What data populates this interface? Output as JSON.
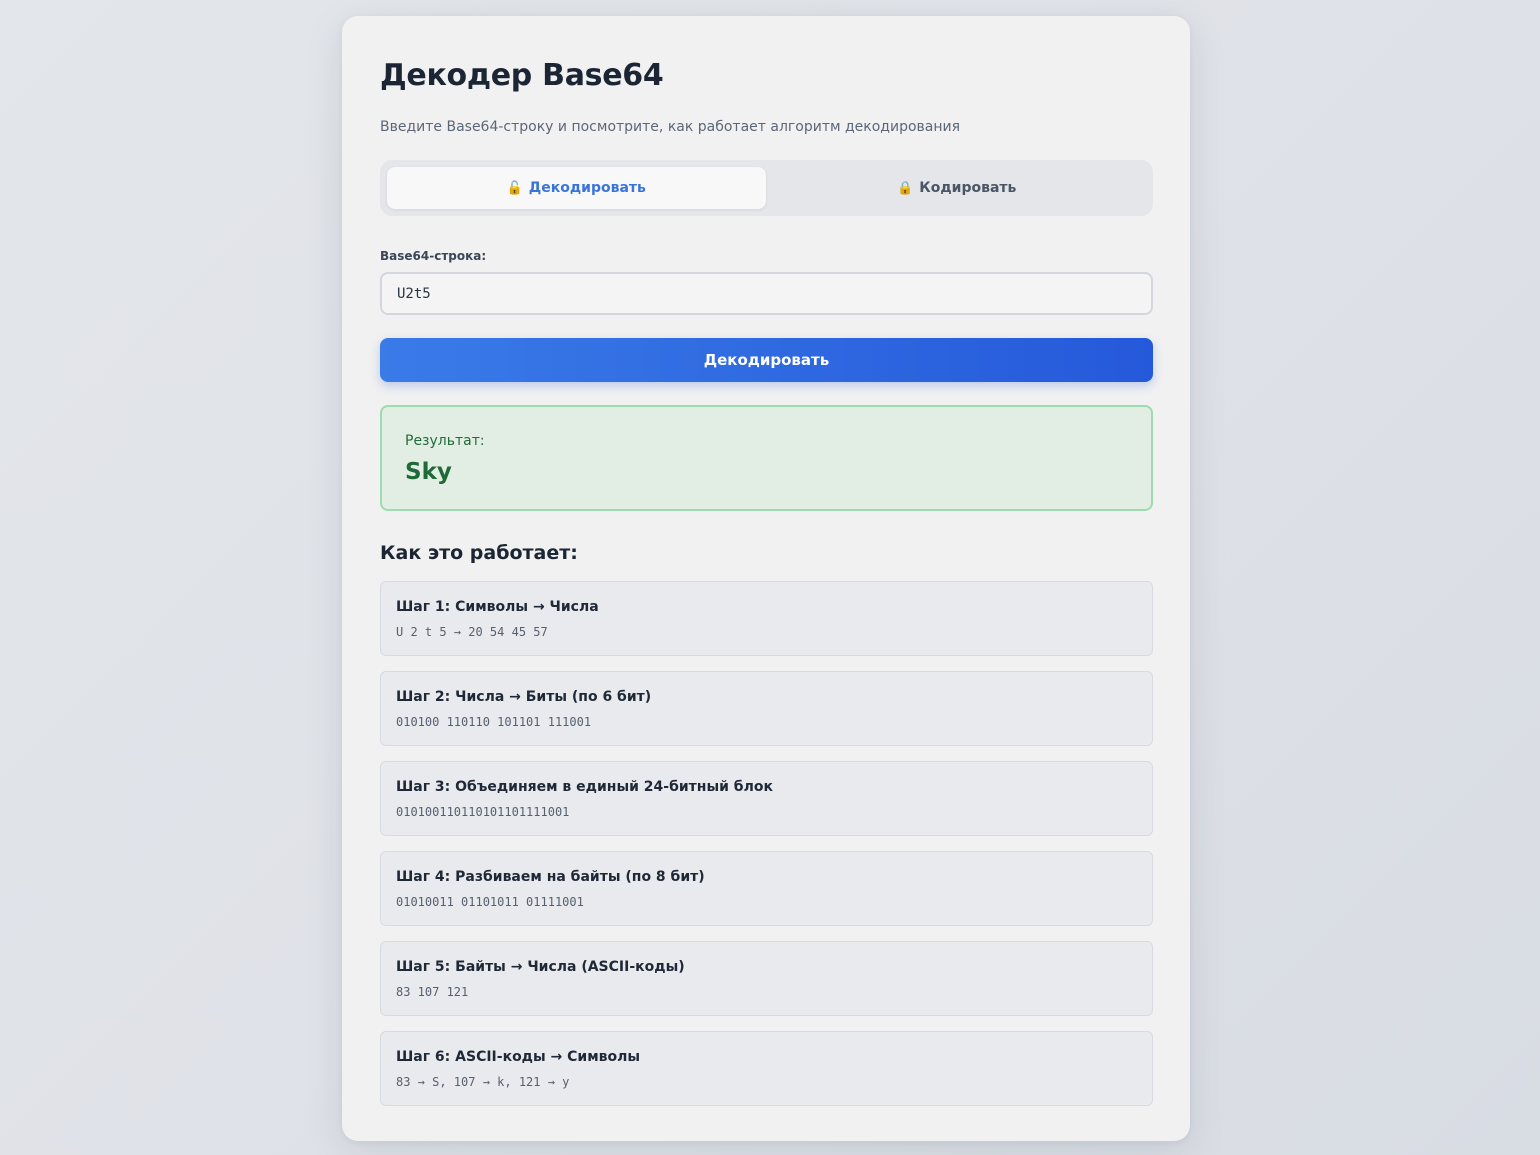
{
  "header": {
    "title": "Декодер Base64",
    "subtitle": "Введите Base64-строку и посмотрите, как работает алгоритм декодирования"
  },
  "tabs": [
    {
      "label": "Декодировать",
      "icon": "unlocked-icon",
      "glyph": "🔓",
      "active": true
    },
    {
      "label": "Кодировать",
      "icon": "locked-icon",
      "glyph": "🔒",
      "active": false
    }
  ],
  "input": {
    "label": "Base64-строка:",
    "value": "U2t5"
  },
  "decode_button": {
    "label": "Декодировать"
  },
  "result": {
    "label": "Результат:",
    "value": "Sky"
  },
  "how_it_works": {
    "title": "Как это работает:",
    "steps": [
      {
        "title": "Шаг 1: Символы → Числа",
        "detail": "U 2 t 5 → 20 54 45 57"
      },
      {
        "title": "Шаг 2: Числа → Биты (по 6 бит)",
        "detail": "010100 110110 101101 111001"
      },
      {
        "title": "Шаг 3: Объединяем в единый 24-битный блок",
        "detail": "010100110110101101111001"
      },
      {
        "title": "Шаг 4: Разбиваем на байты (по 8 бит)",
        "detail": "01010011 01101011 01111001"
      },
      {
        "title": "Шаг 5: Байты → Числа (ASCII-коды)",
        "detail": "83 107 121"
      },
      {
        "title": "Шаг 6: ASCII-коды → Символы",
        "detail": "83 → S, 107 → k, 121 → y"
      }
    ]
  },
  "colors": {
    "accent": "#3b74d8",
    "button_start": "#3a7be8",
    "button_end": "#2559da",
    "success_bg": "#e2eee4",
    "success_border": "#9ddcae",
    "success_text": "#1f6a36"
  }
}
